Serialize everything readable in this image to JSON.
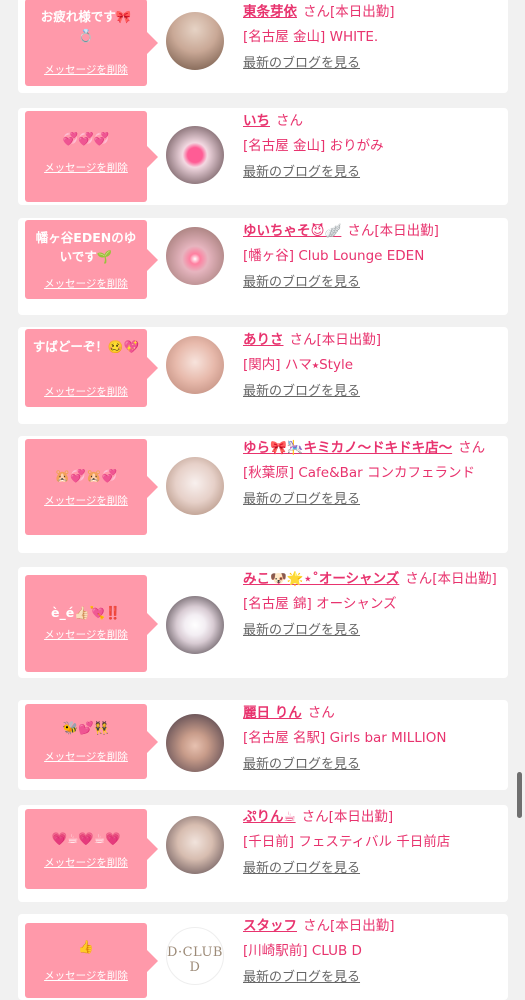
{
  "labels": {
    "delete": "メッセージを削除",
    "blog": "最新のブログを見る"
  },
  "items": [
    {
      "message": "お疲れ様です🎀\n💍",
      "name": "東条芽依",
      "suffix": "さん[本日出勤]",
      "shop": "[名古屋 金山] WHITE.",
      "avatar_colors": [
        "#d8c4b4",
        "#6a5040"
      ]
    },
    {
      "message": "💞💞💞",
      "name": "いち",
      "suffix": "さん",
      "shop": "[名古屋 金山] おりがみ",
      "avatar_colors": [
        "#f0d8e0",
        "#3a2a30"
      ]
    },
    {
      "message": "幡ヶ谷EDENのゆいです🌱",
      "name": "ゆいちゃそ😈🪽",
      "suffix": "さん[本日出勤]",
      "shop": "[幡ヶ谷] Club Lounge EDEN",
      "avatar_colors": [
        "#e8b8c0",
        "#a07a70"
      ]
    },
    {
      "message": "すばどーぞ！🥴💖",
      "name": "ありさ",
      "suffix": "さん[本日出勤]",
      "shop": "[関内] ハマ⭑Style",
      "avatar_colors": [
        "#f4d8d0",
        "#c89080"
      ]
    },
    {
      "message": "🐹💞🐹💞",
      "name": "ゆら🎀🎠キミカノ〜ドキドキ店〜",
      "suffix": "さん",
      "shop": "[秋葉原] Cafe&Bar コンカフェランド",
      "avatar_colors": [
        "#f4ece8",
        "#b09080"
      ]
    },
    {
      "message": "è_é👍🏻💘‼️",
      "name": "みこ🐶🌟⋆˚オーシャンズ",
      "suffix": "さん[本日出勤]",
      "shop": "[名古屋 錦] オーシャンズ",
      "avatar_colors": [
        "#e8e4e8",
        "#3a3038"
      ]
    },
    {
      "message": "🐝💕👯",
      "name": "麗日 りん",
      "suffix": "さん",
      "shop": "[名古屋 名駅] Girls bar MILLION",
      "avatar_colors": [
        "#3a3040",
        "#d8b0a0"
      ]
    },
    {
      "message": "💗☕💗☕💗",
      "name": "ぷりん☕",
      "suffix": "さん[本日出勤]",
      "shop": "[千日前] フェスティバル 千日前店",
      "avatar_colors": [
        "#e0d0c8",
        "#504048"
      ]
    },
    {
      "message": "👍",
      "name": "スタッフ",
      "suffix": "さん[本日出勤]",
      "shop": "[川崎駅前] CLUB D",
      "logo_text": "D·CLUB D"
    }
  ]
}
